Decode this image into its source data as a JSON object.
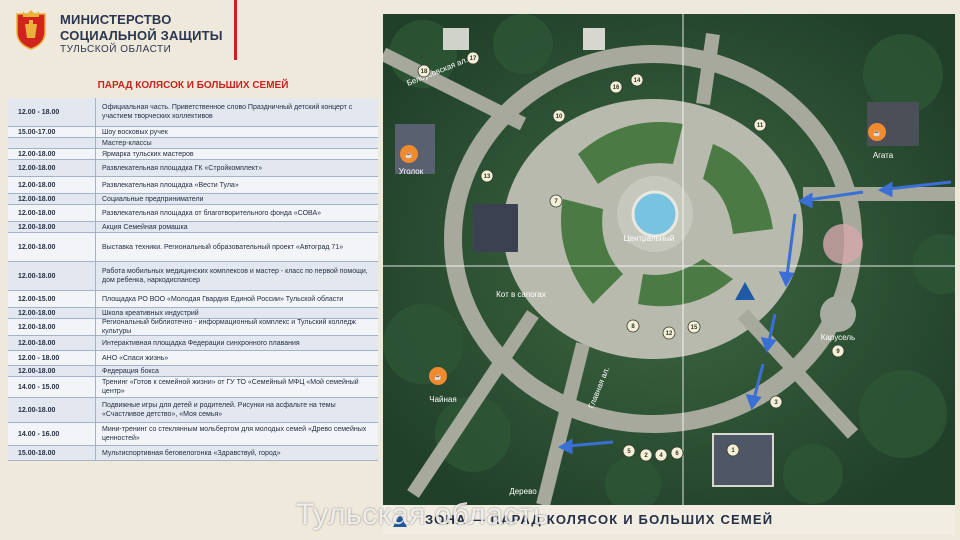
{
  "header": {
    "ministry_line1": "МИНИСТЕРСТВО",
    "ministry_line2": "СОЦИАЛЬНОЙ ЗАЩИТЫ",
    "region": "ТУЛЬСКОЙ ОБЛАСТИ"
  },
  "schedule": {
    "title": "ПАРАД КОЛЯСОК И БОЛЬШИХ СЕМЕЙ",
    "rows": [
      {
        "time": "12.00 - 18.00",
        "event": "Официальная часть. Приветственное слово Праздничный детский концерт с участием творческих коллективов"
      },
      {
        "time": "15.00-17.00",
        "event": "Шоу восковых ручек"
      },
      {
        "time": "",
        "event": "Мастер-классы"
      },
      {
        "time": "12.00-18.00",
        "event": "Ярмарка тульских мастеров"
      },
      {
        "time": "12.00-18.00",
        "event": "Развлекательная площадка ГК «Стройкомплект»"
      },
      {
        "time": "12.00-18.00",
        "event": "Развлекательная площадка «Вести Тула»"
      },
      {
        "time": "12.00-18.00",
        "event": "Социальные предприниматели"
      },
      {
        "time": "12.00-18.00",
        "event": "Развлекательная площадка от благотворительного фонда «СОВА»"
      },
      {
        "time": "12.00-18.00",
        "event": "Акция Семейная ромашка"
      },
      {
        "time": "12.00-18.00",
        "event": "Выставка техники. Региональный образовательный проект «Автоград 71»"
      },
      {
        "time": "12.00-18.00",
        "event": "Работа мобильных медицинских комплексов и мастер - класс по первой помощи, дом ребенка, наркодиспансер"
      },
      {
        "time": "12.00-15.00",
        "event": "Площадка РО ВОО «Молодая Гвардия Единой России» Тульской области"
      },
      {
        "time": "12.00-18.00",
        "event": "Школа креативных индустрий"
      },
      {
        "time": "12.00-18.00",
        "event": "Региональный библиотечно - информационный комплекс и Тульский колледж культуры"
      },
      {
        "time": "12.00-18.00",
        "event": "Интерактивная площадка Федерации синхронного плавания"
      },
      {
        "time": "12.00 - 18.00",
        "event": "АНО «Спаси жизнь»"
      },
      {
        "time": "12.00-18.00",
        "event": "Федерация бокса"
      },
      {
        "time": "14.00 - 15.00",
        "event": "Тренинг «Готов к семейной жизни» от ГУ ТО «Семейный МФЦ «Мой семейный центр»"
      },
      {
        "time": "12.00-18.00",
        "event": "Подвижные игры для детей и родителей. Рисунки на асфальте на темы «Счастливое детство», «Моя семья»"
      },
      {
        "time": "14.00 - 16.00",
        "event": "Мини-тренинг со стеклянным мольбертом для молодых семей «Древо семейных ценностей»"
      },
      {
        "time": "15.00-18.00",
        "event": "Мультиспортивная беговелогонка «Здравствуй, город»"
      }
    ]
  },
  "map": {
    "labels": {
      "central": "Центральный",
      "kot": "Кот в сапогах",
      "chainaya": "Чайная",
      "agata": "Агата",
      "ugolok": "Уголок",
      "derevo": "Дерево",
      "karusel": "Карусель",
      "street_top": "Белоусовская ал.",
      "street_side": "Главная ал."
    },
    "markers": [
      "1",
      "2",
      "3",
      "4",
      "5",
      "6",
      "7",
      "8",
      "9",
      "10",
      "11",
      "12",
      "13",
      "14",
      "15",
      "16",
      "17",
      "18"
    ]
  },
  "banner": {
    "title": "ЗОНА — ПАРАД КОЛЯСОК И БОЛЬШИХ СЕМЕЙ"
  },
  "watermark": "Тульская область",
  "colors": {
    "accent_red": "#c8231f",
    "navy": "#243047",
    "map_arrow": "#3a6fd6"
  }
}
